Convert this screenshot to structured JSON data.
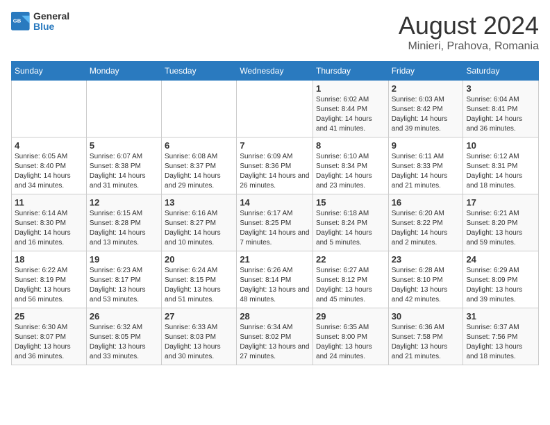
{
  "logo": {
    "line1": "General",
    "line2": "Blue"
  },
  "title": "August 2024",
  "subtitle": "Minieri, Prahova, Romania",
  "weekdays": [
    "Sunday",
    "Monday",
    "Tuesday",
    "Wednesday",
    "Thursday",
    "Friday",
    "Saturday"
  ],
  "weeks": [
    [
      {
        "day": "",
        "info": ""
      },
      {
        "day": "",
        "info": ""
      },
      {
        "day": "",
        "info": ""
      },
      {
        "day": "",
        "info": ""
      },
      {
        "day": "1",
        "info": "Sunrise: 6:02 AM\nSunset: 8:44 PM\nDaylight: 14 hours and 41 minutes."
      },
      {
        "day": "2",
        "info": "Sunrise: 6:03 AM\nSunset: 8:42 PM\nDaylight: 14 hours and 39 minutes."
      },
      {
        "day": "3",
        "info": "Sunrise: 6:04 AM\nSunset: 8:41 PM\nDaylight: 14 hours and 36 minutes."
      }
    ],
    [
      {
        "day": "4",
        "info": "Sunrise: 6:05 AM\nSunset: 8:40 PM\nDaylight: 14 hours and 34 minutes."
      },
      {
        "day": "5",
        "info": "Sunrise: 6:07 AM\nSunset: 8:38 PM\nDaylight: 14 hours and 31 minutes."
      },
      {
        "day": "6",
        "info": "Sunrise: 6:08 AM\nSunset: 8:37 PM\nDaylight: 14 hours and 29 minutes."
      },
      {
        "day": "7",
        "info": "Sunrise: 6:09 AM\nSunset: 8:36 PM\nDaylight: 14 hours and 26 minutes."
      },
      {
        "day": "8",
        "info": "Sunrise: 6:10 AM\nSunset: 8:34 PM\nDaylight: 14 hours and 23 minutes."
      },
      {
        "day": "9",
        "info": "Sunrise: 6:11 AM\nSunset: 8:33 PM\nDaylight: 14 hours and 21 minutes."
      },
      {
        "day": "10",
        "info": "Sunrise: 6:12 AM\nSunset: 8:31 PM\nDaylight: 14 hours and 18 minutes."
      }
    ],
    [
      {
        "day": "11",
        "info": "Sunrise: 6:14 AM\nSunset: 8:30 PM\nDaylight: 14 hours and 16 minutes."
      },
      {
        "day": "12",
        "info": "Sunrise: 6:15 AM\nSunset: 8:28 PM\nDaylight: 14 hours and 13 minutes."
      },
      {
        "day": "13",
        "info": "Sunrise: 6:16 AM\nSunset: 8:27 PM\nDaylight: 14 hours and 10 minutes."
      },
      {
        "day": "14",
        "info": "Sunrise: 6:17 AM\nSunset: 8:25 PM\nDaylight: 14 hours and 7 minutes."
      },
      {
        "day": "15",
        "info": "Sunrise: 6:18 AM\nSunset: 8:24 PM\nDaylight: 14 hours and 5 minutes."
      },
      {
        "day": "16",
        "info": "Sunrise: 6:20 AM\nSunset: 8:22 PM\nDaylight: 14 hours and 2 minutes."
      },
      {
        "day": "17",
        "info": "Sunrise: 6:21 AM\nSunset: 8:20 PM\nDaylight: 13 hours and 59 minutes."
      }
    ],
    [
      {
        "day": "18",
        "info": "Sunrise: 6:22 AM\nSunset: 8:19 PM\nDaylight: 13 hours and 56 minutes."
      },
      {
        "day": "19",
        "info": "Sunrise: 6:23 AM\nSunset: 8:17 PM\nDaylight: 13 hours and 53 minutes."
      },
      {
        "day": "20",
        "info": "Sunrise: 6:24 AM\nSunset: 8:15 PM\nDaylight: 13 hours and 51 minutes."
      },
      {
        "day": "21",
        "info": "Sunrise: 6:26 AM\nSunset: 8:14 PM\nDaylight: 13 hours and 48 minutes."
      },
      {
        "day": "22",
        "info": "Sunrise: 6:27 AM\nSunset: 8:12 PM\nDaylight: 13 hours and 45 minutes."
      },
      {
        "day": "23",
        "info": "Sunrise: 6:28 AM\nSunset: 8:10 PM\nDaylight: 13 hours and 42 minutes."
      },
      {
        "day": "24",
        "info": "Sunrise: 6:29 AM\nSunset: 8:09 PM\nDaylight: 13 hours and 39 minutes."
      }
    ],
    [
      {
        "day": "25",
        "info": "Sunrise: 6:30 AM\nSunset: 8:07 PM\nDaylight: 13 hours and 36 minutes."
      },
      {
        "day": "26",
        "info": "Sunrise: 6:32 AM\nSunset: 8:05 PM\nDaylight: 13 hours and 33 minutes."
      },
      {
        "day": "27",
        "info": "Sunrise: 6:33 AM\nSunset: 8:03 PM\nDaylight: 13 hours and 30 minutes."
      },
      {
        "day": "28",
        "info": "Sunrise: 6:34 AM\nSunset: 8:02 PM\nDaylight: 13 hours and 27 minutes."
      },
      {
        "day": "29",
        "info": "Sunrise: 6:35 AM\nSunset: 8:00 PM\nDaylight: 13 hours and 24 minutes."
      },
      {
        "day": "30",
        "info": "Sunrise: 6:36 AM\nSunset: 7:58 PM\nDaylight: 13 hours and 21 minutes."
      },
      {
        "day": "31",
        "info": "Sunrise: 6:37 AM\nSunset: 7:56 PM\nDaylight: 13 hours and 18 minutes."
      }
    ]
  ]
}
